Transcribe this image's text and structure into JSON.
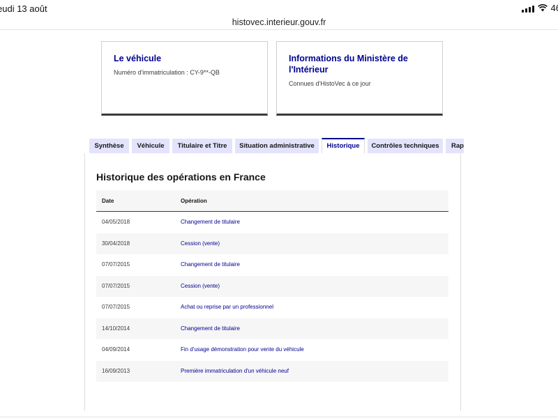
{
  "status": {
    "time": "eudi 13 août",
    "battery": "46"
  },
  "browser": {
    "url": "histovec.interieur.gouv.fr"
  },
  "cards": {
    "vehicle": {
      "title": "Le véhicule",
      "subtitle": "Numéro d'immatriculation : CY-9**-QB"
    },
    "ministry": {
      "title": "Informations du Ministère de l'Intérieur",
      "subtitle": "Connues d'HistoVec à ce jour"
    }
  },
  "tabs": [
    {
      "label": "Synthèse",
      "active": false
    },
    {
      "label": "Véhicule",
      "active": false
    },
    {
      "label": "Titulaire et Titre",
      "active": false
    },
    {
      "label": "Situation administrative",
      "active": false
    },
    {
      "label": "Historique",
      "active": true
    },
    {
      "label": "Contrôles techniques",
      "active": false
    },
    {
      "label": "Rap",
      "active": false
    }
  ],
  "history": {
    "title": "Historique des opérations en France",
    "columns": {
      "date": "Date",
      "operation": "Opération"
    },
    "rows": [
      {
        "date": "04/05/2018",
        "operation": "Changement de titulaire"
      },
      {
        "date": "30/04/2018",
        "operation": "Cession (vente)"
      },
      {
        "date": "07/07/2015",
        "operation": "Changement de titulaire"
      },
      {
        "date": "07/07/2015",
        "operation": "Cession (vente)"
      },
      {
        "date": "07/07/2015",
        "operation": "Achat ou reprise par un professionnel"
      },
      {
        "date": "14/10/2014",
        "operation": "Changement de titulaire"
      },
      {
        "date": "04/09/2014",
        "operation": "Fin d'usage démonstration pour vente du véhicule"
      },
      {
        "date": "16/09/2013",
        "operation": "Première immatriculation d'un véhicule neuf"
      }
    ]
  },
  "colors": {
    "accent": "#000091",
    "tab_background": "#e3e3fd",
    "row_alt": "#f6f6f6"
  }
}
